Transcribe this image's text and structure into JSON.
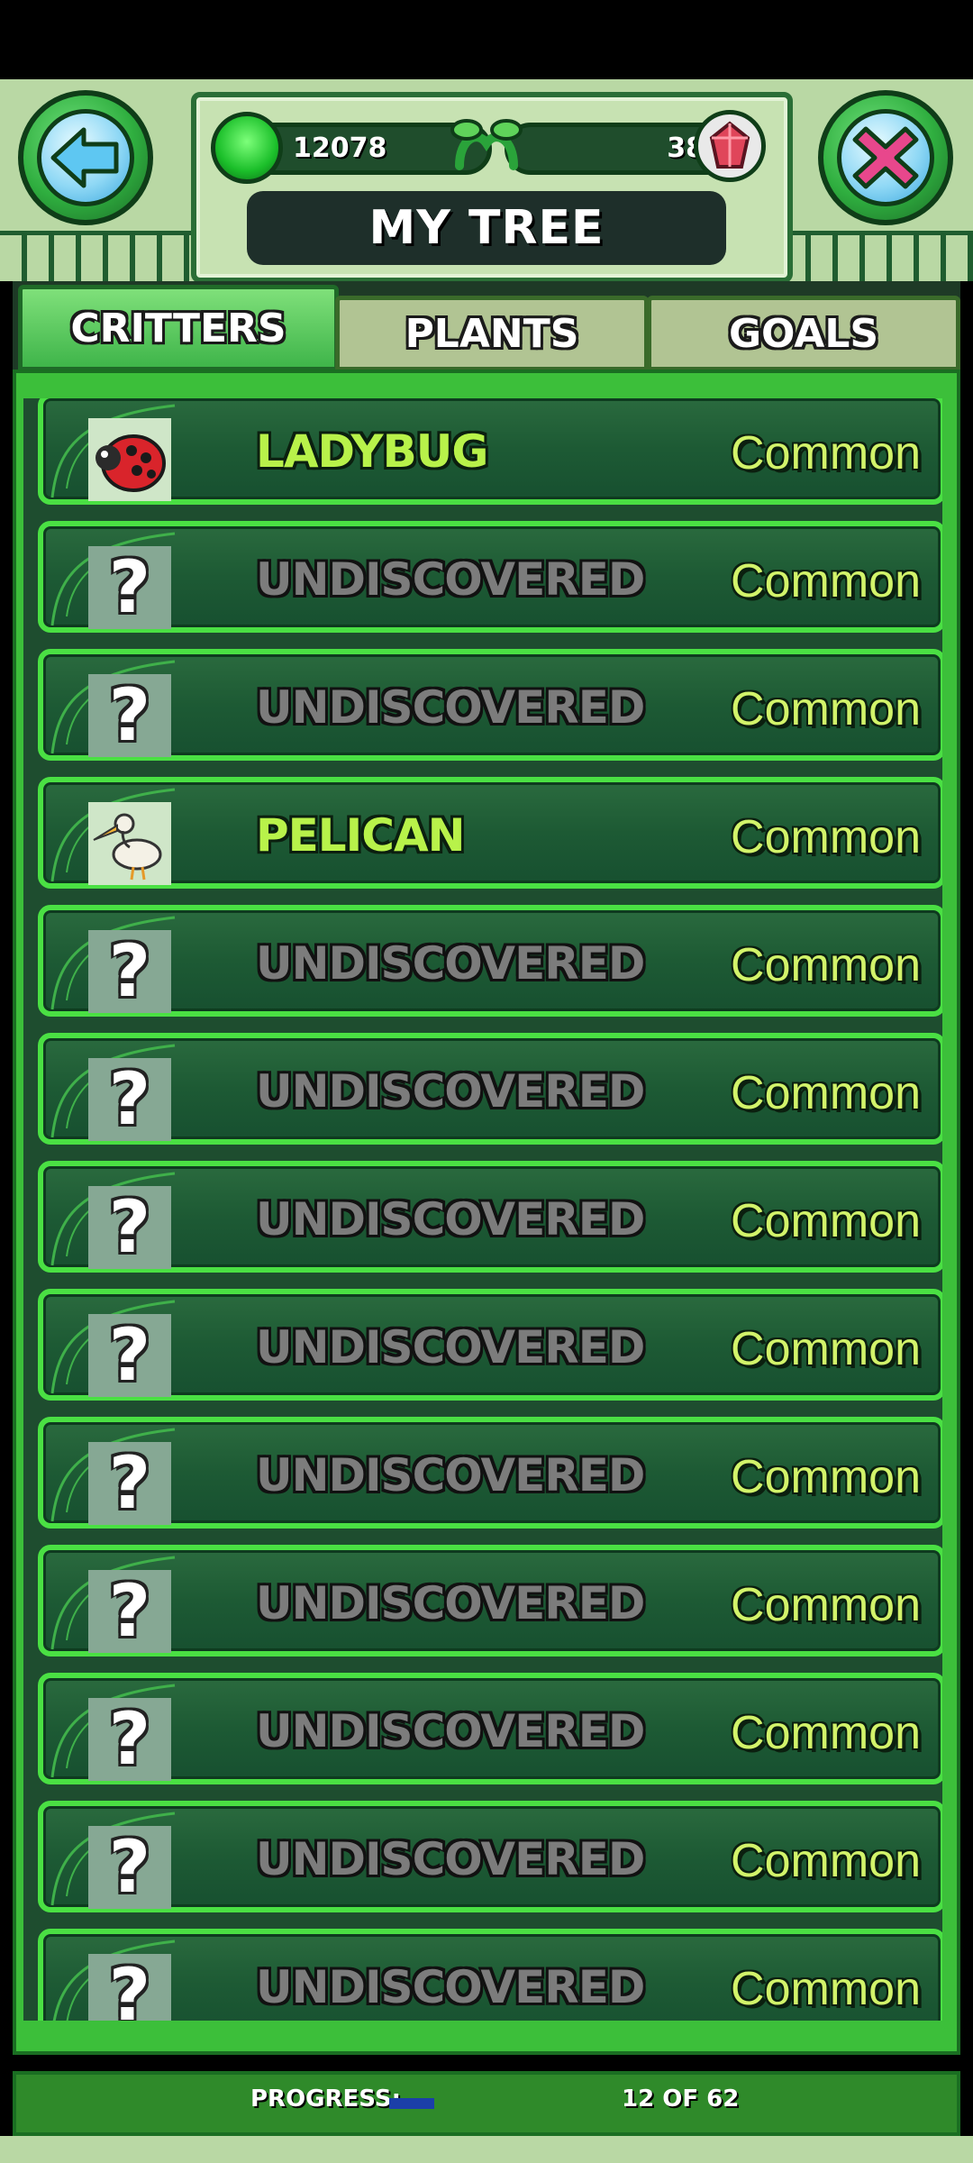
{
  "header": {
    "coins": "12078",
    "gems": "38",
    "title": "MY TREE",
    "back_icon": "arrow-left-icon",
    "close_icon": "close-x-icon"
  },
  "tabs": [
    {
      "label": "CRITTERS",
      "active": true
    },
    {
      "label": "PLANTS",
      "active": false
    },
    {
      "label": "GOALS",
      "active": false
    }
  ],
  "rows": [
    {
      "name": "LADYBUG",
      "rarity": "Common",
      "discovered": true,
      "icon": "ladybug-icon"
    },
    {
      "name": "UNDISCOVERED",
      "rarity": "Common",
      "discovered": false,
      "icon": "question-mark-icon"
    },
    {
      "name": "UNDISCOVERED",
      "rarity": "Common",
      "discovered": false,
      "icon": "question-mark-icon"
    },
    {
      "name": "PELICAN",
      "rarity": "Common",
      "discovered": true,
      "icon": "pelican-icon"
    },
    {
      "name": "UNDISCOVERED",
      "rarity": "Common",
      "discovered": false,
      "icon": "question-mark-icon"
    },
    {
      "name": "UNDISCOVERED",
      "rarity": "Common",
      "discovered": false,
      "icon": "question-mark-icon"
    },
    {
      "name": "UNDISCOVERED",
      "rarity": "Common",
      "discovered": false,
      "icon": "question-mark-icon"
    },
    {
      "name": "UNDISCOVERED",
      "rarity": "Common",
      "discovered": false,
      "icon": "question-mark-icon"
    },
    {
      "name": "UNDISCOVERED",
      "rarity": "Common",
      "discovered": false,
      "icon": "question-mark-icon"
    },
    {
      "name": "UNDISCOVERED",
      "rarity": "Common",
      "discovered": false,
      "icon": "question-mark-icon"
    },
    {
      "name": "UNDISCOVERED",
      "rarity": "Common",
      "discovered": false,
      "icon": "question-mark-icon"
    },
    {
      "name": "UNDISCOVERED",
      "rarity": "Common",
      "discovered": false,
      "icon": "question-mark-icon"
    },
    {
      "name": "UNDISCOVERED",
      "rarity": "Common",
      "discovered": false,
      "icon": "question-mark-icon"
    }
  ],
  "progress": {
    "label": "PROGRESS:",
    "count": "12 OF 62",
    "fraction": 0.19
  },
  "colors": {
    "discovered_name": "#b8f24a",
    "undiscovered_name": "#7c7c7c",
    "rarity": "#d2f36a",
    "row_border": "#4ae043",
    "progress_fill": "#1b3fa8"
  }
}
